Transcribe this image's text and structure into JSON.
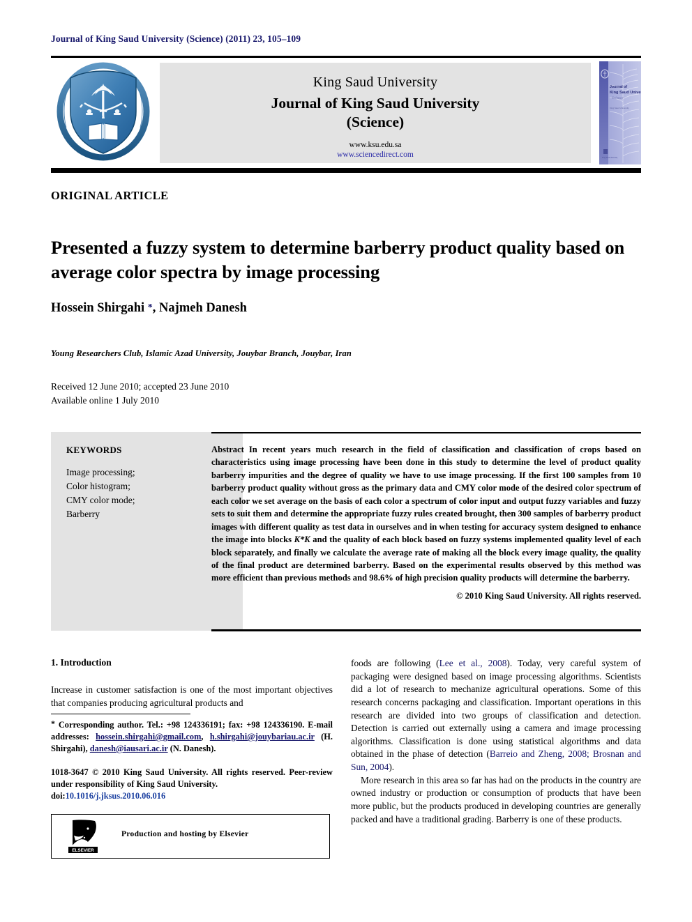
{
  "running_head": "Journal of King Saud University (Science) (2011) 23, 105–109",
  "masthead": {
    "logo_alt": "King Saud University shield emblem with palm tree, crossed swords and open book, dated 1937",
    "university": "King Saud University",
    "journal_line1": "Journal of King Saud University",
    "journal_line2": "(Science)",
    "url_ksu": "www.ksu.edu.sa",
    "url_sciencedirect": "www.sciencedirect.com",
    "cover": {
      "line1": "Journal of",
      "line2": "King Saud University",
      "line3": "Science",
      "line4": "King Saud University"
    }
  },
  "article": {
    "type_label": "ORIGINAL ARTICLE",
    "title": "Presented a fuzzy system to determine barberry product quality based on average color spectra by image processing",
    "authors": "Hossein Shirgahi ",
    "authors_rest": ", Najmeh Danesh",
    "author_marker": "*",
    "affiliation": "Young Researchers Club, Islamic Azad University, Jouybar Branch, Jouybar, Iran",
    "received": "Received 12 June 2010; accepted 23 June 2010",
    "available": "Available online 1 July 2010"
  },
  "keywords": {
    "heading": "KEYWORDS",
    "items": [
      "Image processing;",
      "Color histogram;",
      "CMY color mode;",
      "Barberry"
    ]
  },
  "abstract": {
    "label": "Abstract",
    "text": "In recent years much research in the field of classification and classification of crops based on characteristics using image processing have been done in this study to determine the level of product quality barberry impurities and the degree of quality we have to use image processing. If the first 100 samples from 10 barberry product quality without gross as the primary data and CMY color mode of the desired color spectrum of each color we set average on the basis of each color a spectrum of color input and output fuzzy variables and fuzzy sets to suit them and determine the appropriate fuzzy rules created brought, then 300 samples of barberry product images with different quality as test data in ourselves and in when testing for accuracy system designed to enhance the image into blocks ",
    "math": "K*K",
    "text2": " and the quality of each block based on fuzzy systems implemented quality level of each block separately, and finally we calculate the average rate of making all the block every image quality, the quality of the final product are determined barberry. Based on the experimental results observed by this method was more efficient than previous methods and 98.6% of high precision quality products will determine the barberry.",
    "copyright": "© 2010 King Saud University. All rights reserved."
  },
  "intro": {
    "heading": "1. Introduction",
    "para1": "Increase in customer satisfaction is one of the most important objectives that companies producing agricultural products and"
  },
  "footnote": {
    "marker": "*",
    "corresponding": " Corresponding author. Tel.: +98 124336191; fax: +98 124336190.",
    "email_label": "E-mail addresses:",
    "email1": "hossein.shirgahi@gmail.com",
    "email_sep1": ", ",
    "email2": "h.shirgahi@jouybariau.ac.ir",
    "email_owner1": " (H. Shirgahi), ",
    "email3": "danesh@iausari.ac.ir",
    "email_owner2": " (N. Danesh).",
    "issn_line": "1018-3647 © 2010 King Saud University. All rights reserved. Peer-review under responsibility of King Saud University.",
    "doi_label": "doi:",
    "doi_value": "10.1016/j.jksus.2010.06.016"
  },
  "elsevier": {
    "label": "Production and hosting by Elsevier",
    "logo_text": "ELSEVIER"
  },
  "right_column": {
    "para1_a": "foods are following (",
    "para1_ref1": "Lee et al., 2008",
    "para1_b": "). Today, very careful system of packaging were designed based on image processing algorithms. Scientists did a lot of research to mechanize agricultural operations. Some of this research concerns packaging and classification. Important operations in this research are divided into two groups of classification and detection. Detection is carried out externally using a camera and image processing algorithms. Classification is done using statistical algorithms and data obtained in the phase of detection (",
    "para1_ref2": "Barreio and Zheng, 2008; Brosnan and Sun, 2004",
    "para1_c": ").",
    "para2": "More research in this area so far has had on the products in the country are owned industry or production or consumption of products that have been more public, but the products produced in developing countries are generally packed and have a traditional grading. Barberry is one of these products."
  },
  "colors": {
    "navy": "#17176b",
    "link_blue": "#2b2ba8",
    "gray_box": "#e3e3e3",
    "logo_blue": "#2e6da4"
  }
}
